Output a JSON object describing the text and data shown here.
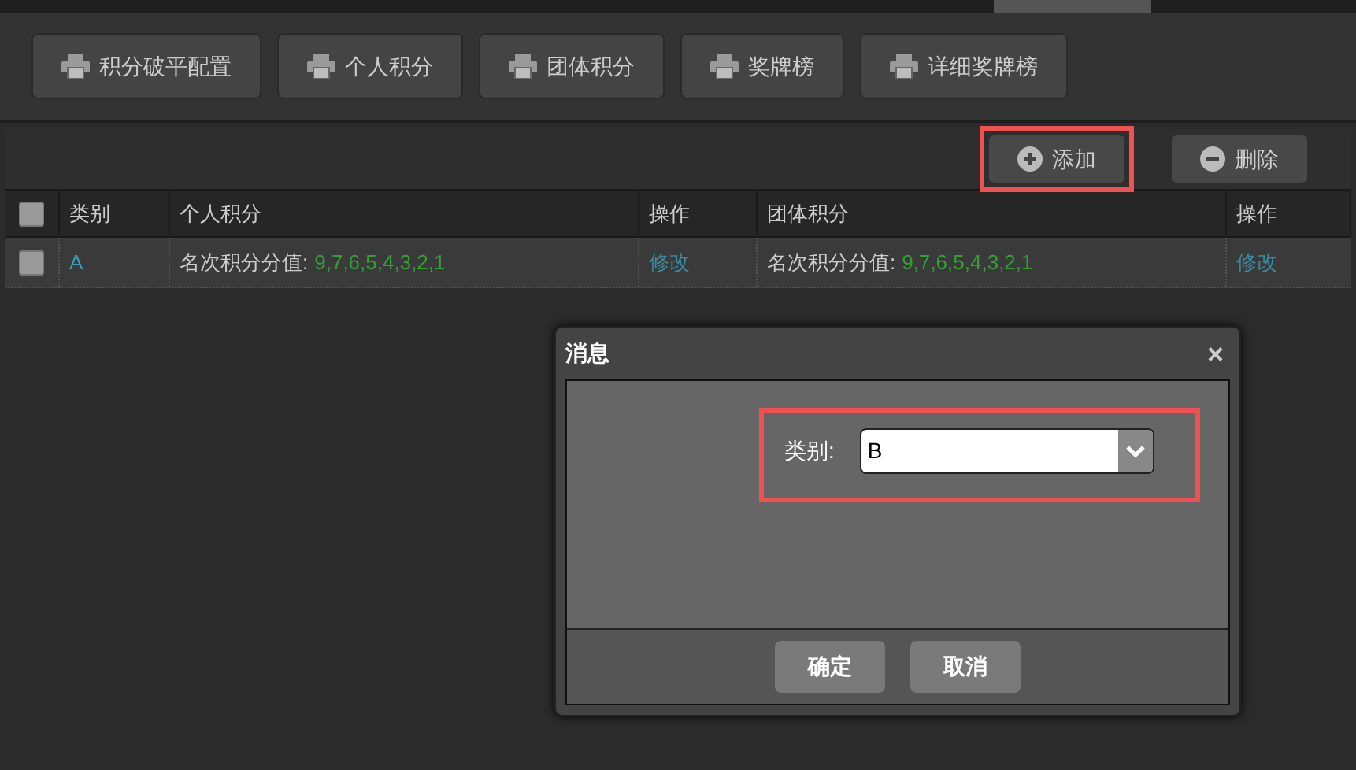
{
  "toolbar": {
    "buttons": [
      "积分破平配置",
      "个人积分",
      "团体积分",
      "奖牌榜",
      "详细奖牌榜"
    ]
  },
  "actions": [
    {
      "kind": "add",
      "label": "添加",
      "highlighted": true
    },
    {
      "kind": "remove",
      "label": "删除",
      "highlighted": false
    }
  ],
  "table": {
    "columns": [
      "类别",
      "个人积分",
      "操作",
      "团体积分",
      "操作"
    ],
    "header_checked": false,
    "rows": [
      {
        "checked": false,
        "category": "A",
        "personal_label": "名次积分分值:",
        "personal_value": "9,7,6,5,4,3,2,1",
        "personal_action": "修改",
        "team_label": "名次积分分值:",
        "team_value": "9,7,6,5,4,3,2,1",
        "team_action": "修改"
      }
    ]
  },
  "dialog": {
    "title": "消息",
    "close": "×",
    "field_label": "类别:",
    "field_value": "B",
    "buttons": [
      "确定",
      "取消"
    ]
  }
}
